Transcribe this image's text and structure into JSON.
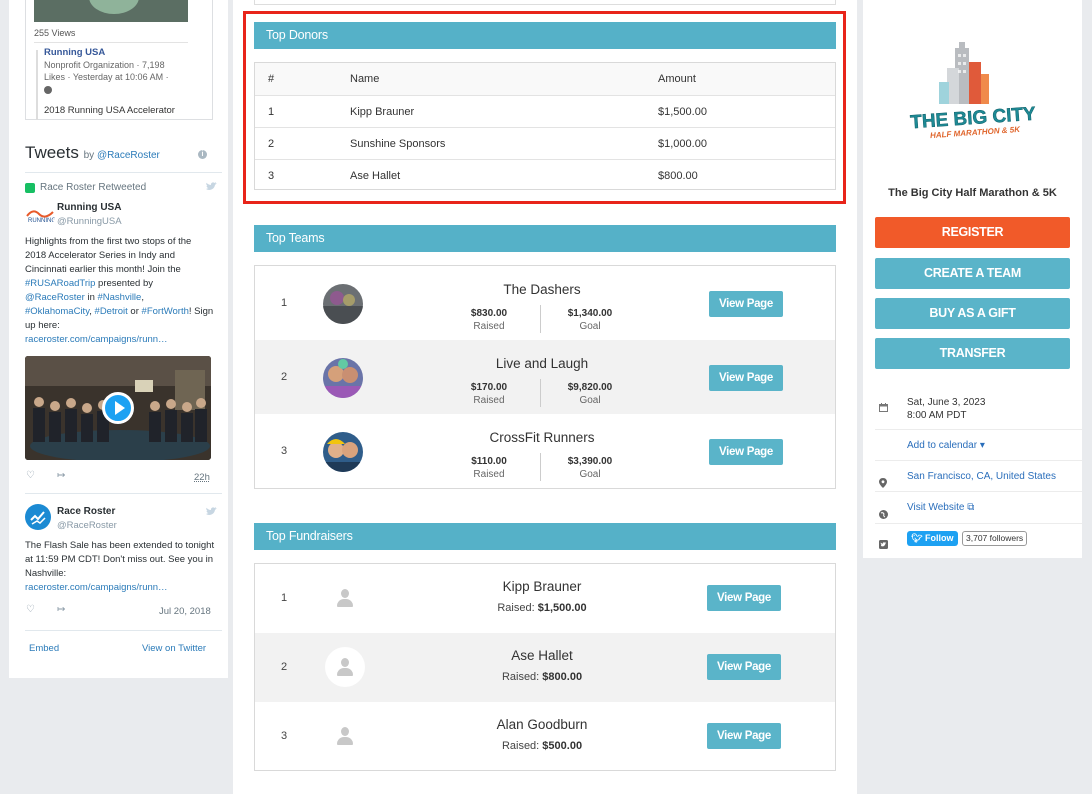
{
  "facebook": {
    "views": "255 Views",
    "page_name": "Running USA",
    "meta": "Nonprofit Organization · 7,198 Likes · Yesterday at 10:06 AM ·",
    "post_title": "2018 Running USA Accelerator"
  },
  "twitter": {
    "title": "Tweets",
    "by": "by",
    "by_handle": "@RaceRoster",
    "retweeted_label": "Race Roster Retweeted",
    "tweet1": {
      "name": "Running USA",
      "handle": "@RunningUSA",
      "text_parts": [
        "Highlights from the first two stops of the 2018 Accelerator Series in Indy and Cincinnati earlier this month! Join the ",
        "#RUSARoadTrip",
        " presented by ",
        "@RaceRoster",
        " in ",
        "#Nashville",
        ", ",
        "#OklahomaCity",
        ", ",
        "#Detroit",
        " or ",
        "#FortWorth",
        "! Sign up here: ",
        "raceroster.com/campaigns/runn…"
      ],
      "time": "22h"
    },
    "tweet2": {
      "name": "Race Roster",
      "handle": "@RaceRoster",
      "text": "The Flash Sale has been extended to tonight at 11:59 PM CDT! Don't miss out. See you in Nashville:",
      "link": "raceroster.com/campaigns/runn…",
      "date": "Jul 20, 2018"
    },
    "embed_label": "Embed",
    "view_on_twitter_label": "View on Twitter"
  },
  "top_donors": {
    "heading": "Top Donors",
    "columns": [
      "#",
      "Name",
      "Amount"
    ],
    "rows": [
      {
        "rank": "1",
        "name": "Kipp Brauner",
        "amount": "$1,500.00"
      },
      {
        "rank": "2",
        "name": "Sunshine Sponsors",
        "amount": "$1,000.00"
      },
      {
        "rank": "3",
        "name": "Ase Hallet",
        "amount": "$800.00"
      }
    ]
  },
  "top_teams": {
    "heading": "Top Teams",
    "raised_label": "Raised",
    "goal_label": "Goal",
    "view_label": "View Page",
    "rows": [
      {
        "rank": "1",
        "name": "The Dashers",
        "raised": "$830.00",
        "goal": "$1,340.00"
      },
      {
        "rank": "2",
        "name": "Live and Laugh",
        "raised": "$170.00",
        "goal": "$9,820.00"
      },
      {
        "rank": "3",
        "name": "CrossFit Runners",
        "raised": "$110.00",
        "goal": "$3,390.00"
      }
    ]
  },
  "top_fundraisers": {
    "heading": "Top Fundraisers",
    "raised_prefix": "Raised:",
    "view_label": "View Page",
    "rows": [
      {
        "rank": "1",
        "name": "Kipp Brauner",
        "raised": "$1,500.00"
      },
      {
        "rank": "2",
        "name": "Ase Hallet",
        "raised": "$800.00"
      },
      {
        "rank": "3",
        "name": "Alan Goodburn",
        "raised": "$500.00"
      }
    ]
  },
  "event": {
    "logo_text_main": "THE BIG CITY",
    "logo_text_sub": "HALF MARATHON & 5K",
    "title": "The Big City Half Marathon & 5K",
    "buttons": {
      "register": "REGISTER",
      "create_team": "CREATE A TEAM",
      "buy_gift": "BUY AS A GIFT",
      "transfer": "TRANSFER"
    },
    "date": "Sat, June 3, 2023",
    "time": "8:00 AM PDT",
    "add_calendar": "Add to calendar",
    "location": "San Francisco, CA, United States",
    "website": "Visit Website",
    "follow_label": "Follow",
    "followers": "3,707 followers"
  },
  "colors": {
    "accent_teal": "#55b1c8",
    "register_orange": "#f15a29",
    "highlight_red": "#e8241a",
    "link_blue": "#2a6ebb"
  }
}
